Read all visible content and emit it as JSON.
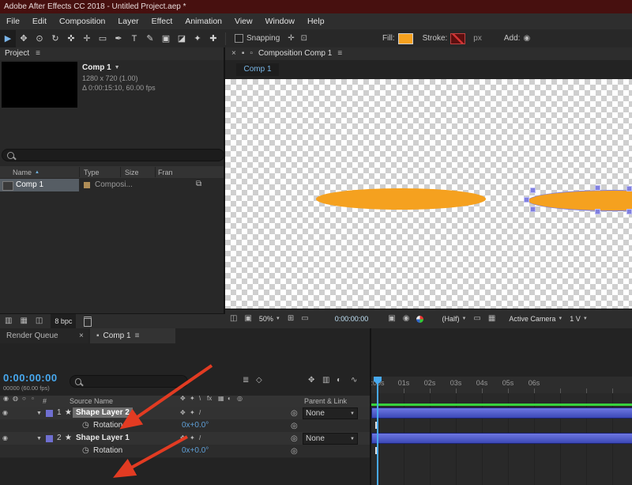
{
  "colors": {
    "accent-orange": "#f5a11f",
    "stroke-red": "#8f1f1f",
    "timecode-blue": "#47a9f0",
    "value-blue": "#5f9fd6",
    "cache-green": "#37d23c",
    "layer-bar-blue": "#4a57c8",
    "arrow-red": "#e23b22",
    "selection-purple": "#8080e0"
  },
  "titlebar": {
    "title": "Adobe After Effects CC 2018 - Untitled Project.aep *"
  },
  "menubar": {
    "items": [
      "File",
      "Edit",
      "Composition",
      "Layer",
      "Effect",
      "Animation",
      "View",
      "Window",
      "Help"
    ]
  },
  "toolbar": {
    "tools": [
      {
        "name": "selection-tool",
        "glyph": "▶"
      },
      {
        "name": "hand-tool",
        "glyph": "✥"
      },
      {
        "name": "zoom-tool",
        "glyph": "⊙"
      },
      {
        "name": "orbit-camera-tool",
        "glyph": "↻"
      },
      {
        "name": "track-camera-tool",
        "glyph": "✜"
      },
      {
        "name": "pan-behind-tool",
        "glyph": "✛"
      },
      {
        "name": "shape-tool",
        "glyph": "▭"
      },
      {
        "name": "pen-tool",
        "glyph": "✒"
      },
      {
        "name": "type-tool",
        "glyph": "T"
      },
      {
        "name": "brush-tool",
        "glyph": "✎"
      },
      {
        "name": "clone-stamp-tool",
        "glyph": "▣"
      },
      {
        "name": "eraser-tool",
        "glyph": "◪"
      },
      {
        "name": "roto-brush-tool",
        "glyph": "✦"
      },
      {
        "name": "puppet-pin-tool",
        "glyph": "✚"
      }
    ],
    "snapping_label": "Snapping",
    "fill_label": "Fill:",
    "stroke_label": "Stroke:",
    "px_label": "px",
    "add_label": "Add:"
  },
  "project_panel": {
    "tab_label": "Project",
    "comp_name": "Comp 1",
    "comp_dims": "1280 x 720 (1.00)",
    "comp_details": "Δ 0:00:15:10, 60.00 fps",
    "columns": [
      "Name",
      "Type",
      "Size",
      "Fran"
    ],
    "row": {
      "name": "Comp 1",
      "type": "Composi..."
    },
    "bpc_label": "8 bpc"
  },
  "comp_panel": {
    "header_tab": "Composition Comp 1",
    "viewer_tab": "Comp 1",
    "zoom_value": "50%",
    "timecode": "0:00:00:00",
    "resolution": "(Half)",
    "camera_view": "Active Camera",
    "view_layout": "1 V"
  },
  "timeline": {
    "tab_render_queue": "Render Queue",
    "tab_comp": "Comp 1",
    "timecode": "0:00:00:00",
    "frame_info": "00000 (60.00 fps)",
    "col_hash": "#",
    "col_source_name": "Source Name",
    "col_parent": "Parent & Link",
    "ruler": [
      ":00s",
      "01s",
      "02s",
      "03s",
      "04s",
      "05s",
      "06s"
    ],
    "switch_header": [
      "✥",
      "✦",
      "\\",
      "fx",
      "▦",
      "◐",
      "◎"
    ],
    "switch_row": [
      "✥",
      "✦",
      "/"
    ],
    "layers": [
      {
        "index": "1",
        "icon": "★",
        "name": "Shape Layer 2",
        "parent": "None"
      },
      {
        "index": "2",
        "icon": "★",
        "name": "Shape Layer 1",
        "parent": "None"
      }
    ],
    "properties": [
      {
        "name": "Rotation",
        "value": "0x+0.0°"
      },
      {
        "name": "Rotation",
        "value": "0x+0.0°"
      }
    ]
  },
  "icons": {
    "hamburger": "≡",
    "close": "×",
    "panel": "▪",
    "lock": "▫",
    "dropdown": "▼",
    "twirl_open": "▼",
    "sort_asc": "▲",
    "pickwhip": "◎",
    "stopwatch": "◷",
    "eye": "◉",
    "audio": "◍",
    "solo": "○",
    "flowchart": "⧉",
    "mini_monitor": "◫",
    "grid_overlay": "⊞",
    "snapshot": "▣",
    "show_snapshot": "◉",
    "roi": "▭",
    "transparency_grid": "▦",
    "mini_flowchart": "≣",
    "draft_3d": "◇",
    "shy": "✥",
    "frame_blend": "▥",
    "motion_blur": "◐",
    "graph_editor": "∿",
    "snap_option_a": "✛",
    "snap_option_b": "⊡",
    "add_circle": "◉",
    "bin_a": "▥",
    "bin_b": "▦",
    "bin_c": "◫"
  }
}
